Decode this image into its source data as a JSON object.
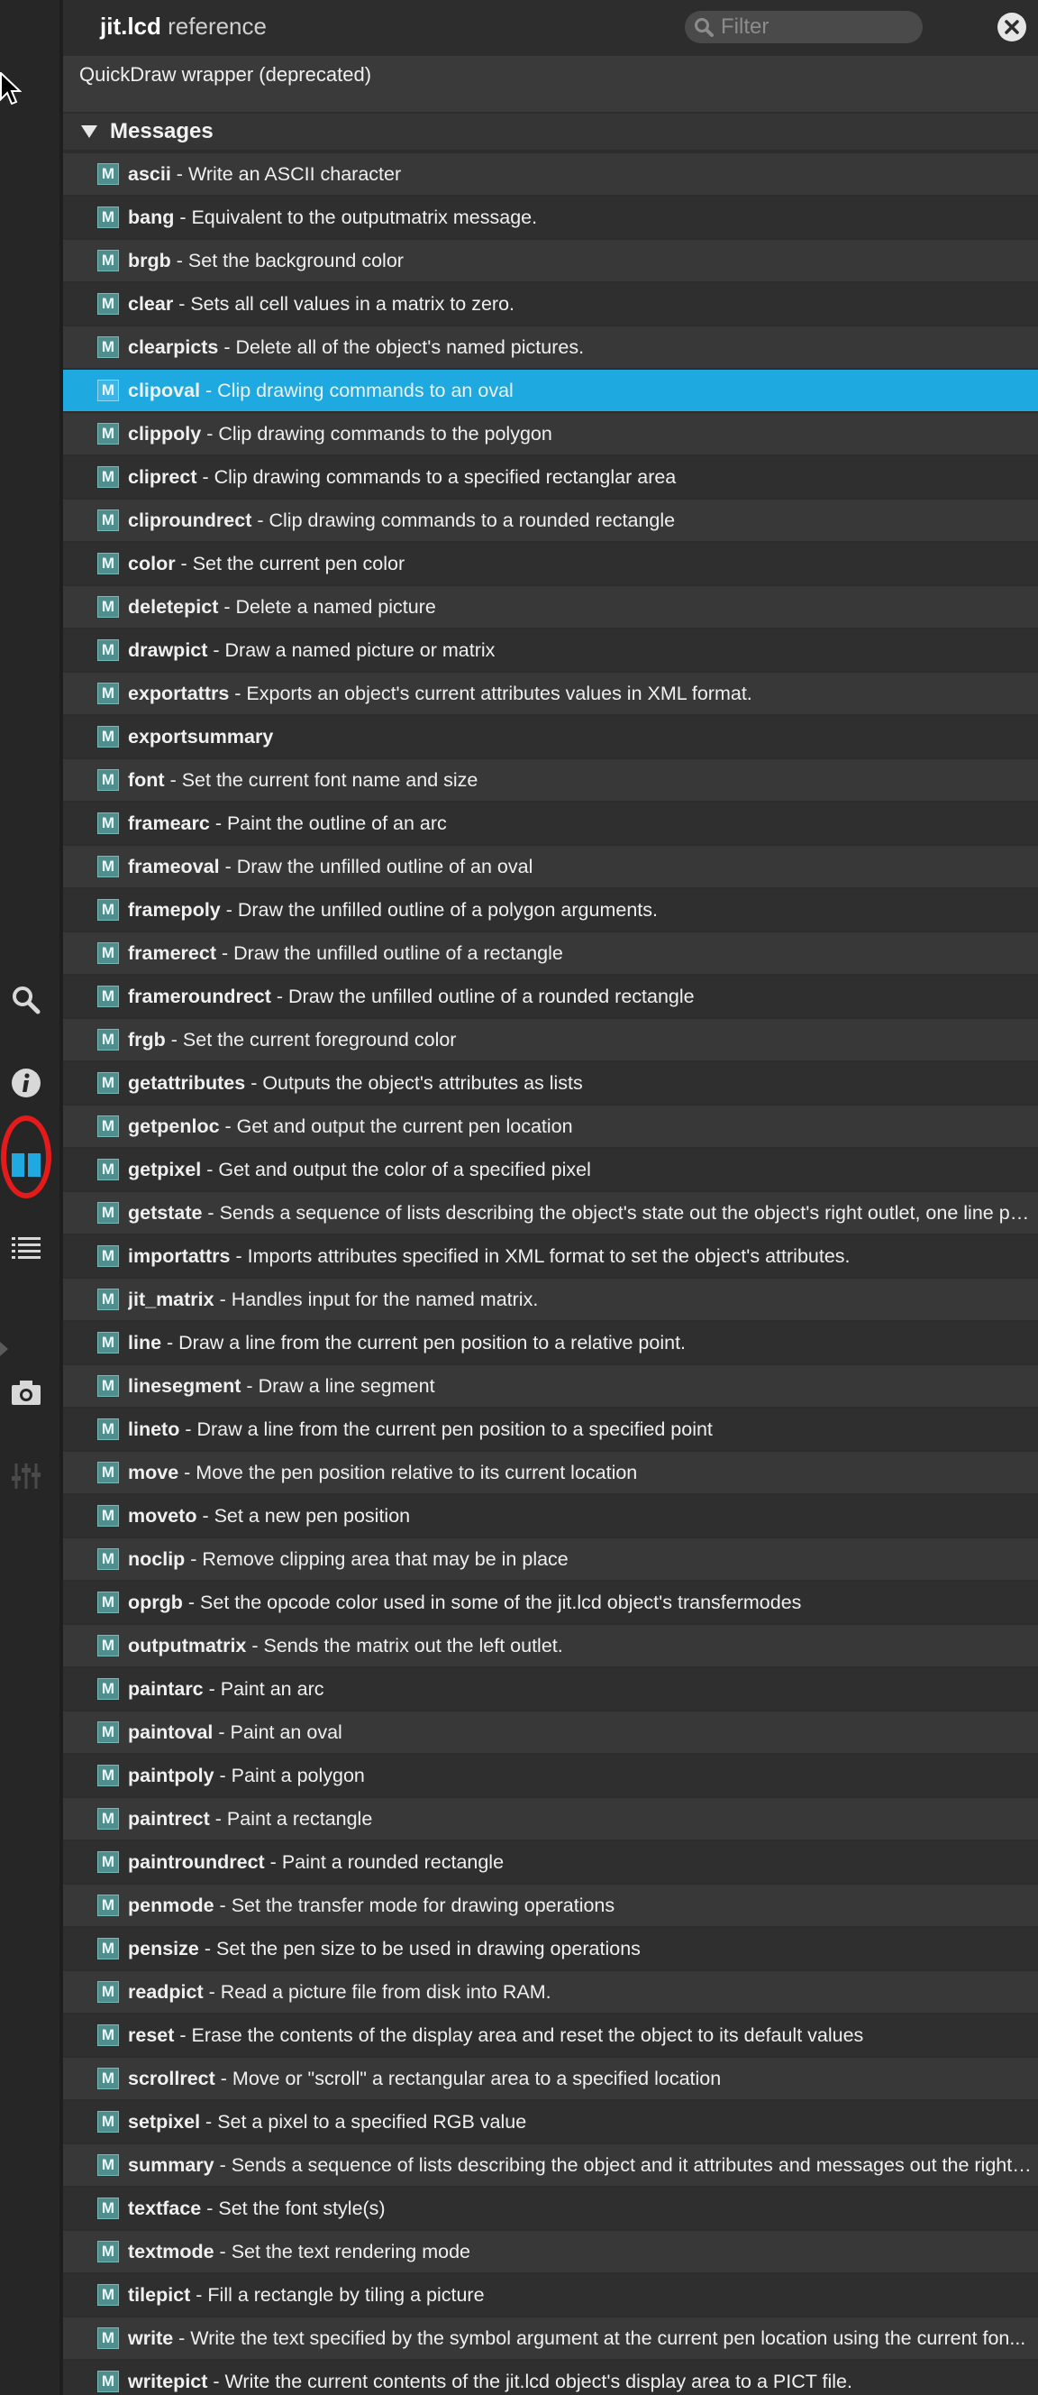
{
  "header": {
    "object_name": "jit.lcd",
    "reference_label": "reference",
    "filter_placeholder": "Filter"
  },
  "subtitle": "QuickDraw wrapper (deprecated)",
  "section": {
    "label": "Messages",
    "expanded": true
  },
  "toolbar": {
    "icons": [
      "search-icon",
      "info-icon",
      "reference-icon",
      "list-icon",
      "snapshot-icon",
      "mixer-icon"
    ],
    "active_icon": "reference-icon",
    "highlight_color": "#e41b1b",
    "accent_color": "#1ea9e1"
  },
  "messages": [
    {
      "name": "ascii",
      "desc": "Write an ASCII character"
    },
    {
      "name": "bang",
      "desc": "Equivalent to the outputmatrix message."
    },
    {
      "name": "brgb",
      "desc": "Set the background color"
    },
    {
      "name": "clear",
      "desc": "Sets all cell values in a matrix to zero."
    },
    {
      "name": "clearpicts",
      "desc": "Delete all of the object's named pictures."
    },
    {
      "name": "clipoval",
      "desc": "Clip drawing commands to an oval",
      "selected": true
    },
    {
      "name": "clippoly",
      "desc": "Clip drawing commands to the polygon"
    },
    {
      "name": "cliprect",
      "desc": "Clip drawing commands to a specified rectanglar area"
    },
    {
      "name": "cliproundrect",
      "desc": "Clip drawing commands to a rounded rectangle"
    },
    {
      "name": "color",
      "desc": "Set the current pen color"
    },
    {
      "name": "deletepict",
      "desc": "Delete a named picture"
    },
    {
      "name": "drawpict",
      "desc": "Draw a named picture or matrix"
    },
    {
      "name": "exportattrs",
      "desc": "Exports an object's current attributes values in XML format."
    },
    {
      "name": "exportsummary",
      "desc": ""
    },
    {
      "name": "font",
      "desc": "Set the current font name and size"
    },
    {
      "name": "framearc",
      "desc": "Paint the outline of an arc"
    },
    {
      "name": "frameoval",
      "desc": "Draw the unfilled outline of an oval"
    },
    {
      "name": "framepoly",
      "desc": "Draw the unfilled outline of a polygon arguments."
    },
    {
      "name": "framerect",
      "desc": "Draw the unfilled outline of a rectangle"
    },
    {
      "name": "frameroundrect",
      "desc": "Draw the unfilled outline of a rounded rectangle"
    },
    {
      "name": "frgb",
      "desc": "Set the current foreground color"
    },
    {
      "name": "getattributes",
      "desc": "Outputs the object's attributes as lists"
    },
    {
      "name": "getpenloc",
      "desc": "Get and output the current pen location"
    },
    {
      "name": "getpixel",
      "desc": "Get and output the color of a specified pixel"
    },
    {
      "name": "getstate",
      "desc": "Sends a sequence of lists describing the object's state out the object's right outlet, one line per..."
    },
    {
      "name": "importattrs",
      "desc": "Imports attributes specified in XML format to set the object's attributes."
    },
    {
      "name": "jit_matrix",
      "desc": "Handles input for the named matrix."
    },
    {
      "name": "line",
      "desc": "Draw a line from the current pen position to a relative point."
    },
    {
      "name": "linesegment",
      "desc": "Draw a line segment"
    },
    {
      "name": "lineto",
      "desc": "Draw a line from the current pen position to a specified point"
    },
    {
      "name": "move",
      "desc": "Move the pen position relative to its current location"
    },
    {
      "name": "moveto",
      "desc": "Set a new pen position"
    },
    {
      "name": "noclip",
      "desc": "Remove clipping area that may be in place"
    },
    {
      "name": "oprgb",
      "desc": "Set the opcode color used in some of the jit.lcd object's transfermodes"
    },
    {
      "name": "outputmatrix",
      "desc": "Sends the matrix out the left outlet."
    },
    {
      "name": "paintarc",
      "desc": "Paint an arc"
    },
    {
      "name": "paintoval",
      "desc": "Paint an oval"
    },
    {
      "name": "paintpoly",
      "desc": "Paint a polygon"
    },
    {
      "name": "paintrect",
      "desc": "Paint a rectangle"
    },
    {
      "name": "paintroundrect",
      "desc": "Paint a rounded rectangle"
    },
    {
      "name": "penmode",
      "desc": "Set the transfer mode for drawing operations"
    },
    {
      "name": "pensize",
      "desc": "Set the pen size to be used in drawing operations"
    },
    {
      "name": "readpict",
      "desc": "Read a picture file from disk into RAM."
    },
    {
      "name": "reset",
      "desc": "Erase the contents of the display area and reset the object to its default values"
    },
    {
      "name": "scrollrect",
      "desc": "Move or \"scroll\" a rectangular area to a specified location"
    },
    {
      "name": "setpixel",
      "desc": "Set a pixel to a specified RGB value"
    },
    {
      "name": "summary",
      "desc": "Sends a sequence of lists describing the object and it attributes and messages out the rightm..."
    },
    {
      "name": "textface",
      "desc": "Set the font style(s)"
    },
    {
      "name": "textmode",
      "desc": "Set the text rendering mode"
    },
    {
      "name": "tilepict",
      "desc": "Fill a rectangle by tiling a picture"
    },
    {
      "name": "write",
      "desc": "Write the text specified by the symbol argument at the current pen location using the current fon..."
    },
    {
      "name": "writepict",
      "desc": "Write the current contents of the jit.lcd object's display area to a PICT file."
    }
  ]
}
